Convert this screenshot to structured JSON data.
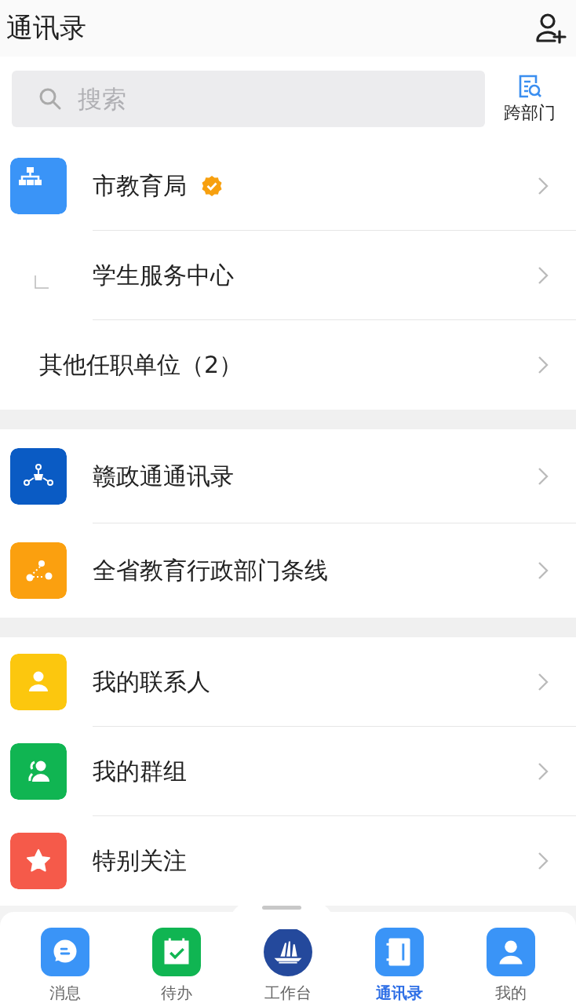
{
  "header": {
    "title": "通讯录"
  },
  "search": {
    "placeholder": "搜索",
    "cross_department": "跨部门"
  },
  "sections": [
    {
      "rows": [
        {
          "kind": "org",
          "label": "市教育局",
          "color": "#3a94f7",
          "verified": true
        },
        {
          "kind": "branch",
          "label": "学生服务中心",
          "verified": false
        },
        {
          "kind": "plain",
          "label": "其他任职单位（2）",
          "verified": false
        }
      ]
    },
    {
      "rows": [
        {
          "kind": "network",
          "label": "赣政通通讯录",
          "color": "#0a5bc4",
          "verified": false
        },
        {
          "kind": "line",
          "label": "全省教育行政部门条线",
          "color": "#fba00f",
          "verified": false
        }
      ]
    },
    {
      "rows": [
        {
          "kind": "contact",
          "label": "我的联系人",
          "color": "#fcc70e",
          "verified": false
        },
        {
          "kind": "group",
          "label": "我的群组",
          "color": "#10b552",
          "verified": false
        },
        {
          "kind": "star",
          "label": "特别关注",
          "color": "#f55a4a",
          "verified": false
        }
      ]
    }
  ],
  "tabs": [
    {
      "kind": "message",
      "label": "消息",
      "color": "#3a94f7",
      "selected": false
    },
    {
      "kind": "todo",
      "label": "待办",
      "color": "#10b552",
      "selected": false
    },
    {
      "kind": "workbench",
      "label": "工作台",
      "color": "#24499c",
      "selected": false
    },
    {
      "kind": "contacts",
      "label": "通讯录",
      "color": "#3a94f7",
      "selected": true
    },
    {
      "kind": "me",
      "label": "我的",
      "color": "#3a94f7",
      "selected": false
    }
  ]
}
